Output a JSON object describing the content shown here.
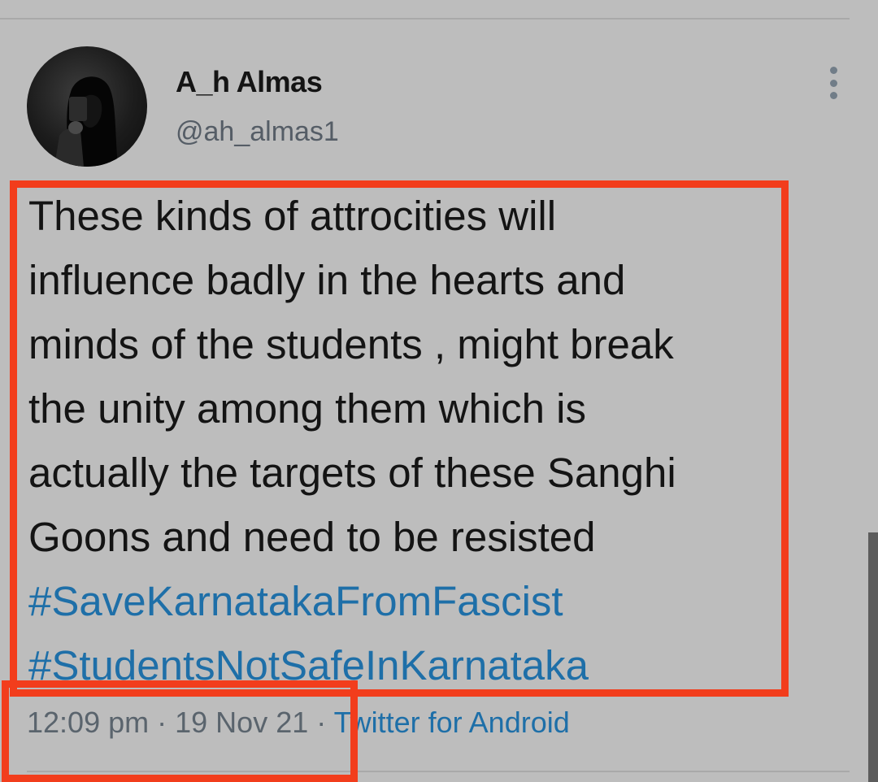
{
  "tweet": {
    "author": {
      "display_name": "A_h Almas",
      "handle": "@ah_almas1",
      "avatar_icon": "avatar-photo"
    },
    "more_icon": "vertical-dots-icon",
    "text_lines": [
      "These kinds of attrocities will",
      "influence badly in the hearts and",
      "minds of the students , might break",
      "the unity among them which is",
      "actually the targets of these Sanghi",
      "Goons and need to be resisted"
    ],
    "hashtags": [
      "#SaveKarnatakaFromFascist",
      "#StudentsNotSafeInKarnataka"
    ],
    "time": "12:09 pm",
    "separator": "·",
    "date": "19 Nov 21",
    "source": "Twitter for Android"
  },
  "colors": {
    "background": "#bdbdbd",
    "text": "#141414",
    "link": "#1e6fa8",
    "secondary": "#5a646d",
    "highlight": "#f23d1c"
  }
}
